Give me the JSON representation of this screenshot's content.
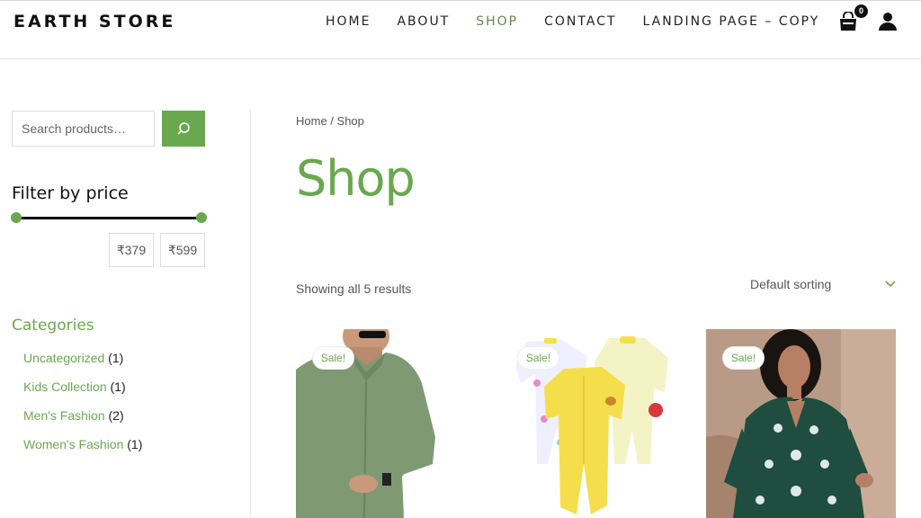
{
  "header": {
    "logo": "EARTH STORE",
    "nav": [
      "HOME",
      "ABOUT",
      "SHOP",
      "CONTACT",
      "LANDING PAGE – COPY"
    ],
    "active_nav": "SHOP",
    "cart_count": "0",
    "cart_icon": "shopping-bag-icon",
    "account_icon": "user-icon"
  },
  "sidebar": {
    "search_placeholder": "Search products…",
    "search_icon": "search-icon",
    "filter_title": "Filter by price",
    "price_min": "₹379",
    "price_max": "₹599",
    "categories_title": "Categories",
    "categories": [
      {
        "label": "Uncategorized",
        "count": "(1)"
      },
      {
        "label": "Kids Collection",
        "count": "(1)"
      },
      {
        "label": "Men's Fashion",
        "count": "(2)"
      },
      {
        "label": "Women's Fashion",
        "count": "(1)"
      }
    ]
  },
  "main": {
    "breadcrumb_home": "Home",
    "breadcrumb_sep": " / ",
    "breadcrumb_current": "Shop",
    "title": "Shop",
    "result_count": "Showing all 5 results",
    "sorting": "Default sorting",
    "products": [
      {
        "badge": "Sale!"
      },
      {
        "badge": "Sale!"
      },
      {
        "badge": "Sale!"
      }
    ]
  },
  "colors": {
    "accent": "#6aa84f",
    "text": "#222222"
  }
}
